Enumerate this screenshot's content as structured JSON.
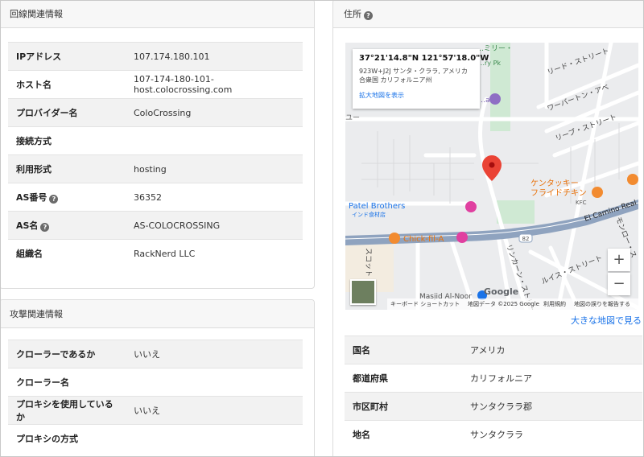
{
  "line_card": {
    "title": "回線関連情報",
    "rows": [
      {
        "key": "IPアドレス",
        "value": "107.174.180.101",
        "help": false
      },
      {
        "key": "ホスト名",
        "value": "107-174-180-101-host.colocrossing.com",
        "help": false
      },
      {
        "key": "プロバイダー名",
        "value": "ColoCrossing",
        "help": false
      },
      {
        "key": "接続方式",
        "value": "",
        "help": false
      },
      {
        "key": "利用形式",
        "value": "hosting",
        "help": false
      },
      {
        "key": "AS番号",
        "value": "36352",
        "help": true
      },
      {
        "key": "AS名",
        "value": "AS-COLOCROSSING",
        "help": true
      },
      {
        "key": "組織名",
        "value": "RackNerd LLC",
        "help": false
      }
    ]
  },
  "attack_card": {
    "title": "攻撃関連情報",
    "rows": [
      {
        "key": "クローラーであるか",
        "value": "いいえ"
      },
      {
        "key": "クローラー名",
        "value": ""
      },
      {
        "key": "プロキシを使用しているか",
        "value": "いいえ"
      },
      {
        "key": "プロキシの方式",
        "value": ""
      }
    ]
  },
  "address_card": {
    "title": "住所",
    "help_icon": "question-circle-icon",
    "map": {
      "coords": "37°21'14.8\"N 121°57'18.0\"W",
      "address": "923W+J2J サンタ・クララ, アメリカ合衆国 カリフォルニア州",
      "enlarge_link": "拡大地図を表示",
      "zoom_in": "+",
      "zoom_out": "−",
      "google_logo": "Google",
      "attribution": {
        "shortcuts": "キーボード ショートカット",
        "map_data": "地図データ ©2025 Google",
        "terms": "利用規約",
        "report": "地図の誤りを報告する"
      },
      "labels": {
        "store_top": "…ミリー・",
        "store_sub": "…ry Pk",
        "art": "…art",
        "street_reed": "リード・ストリート",
        "street_warburton": "ワーバートン・アベ",
        "street_reeve": "リーブ・ストリート",
        "kfc_jp": "ケンタッキー",
        "kfc_jp2": "フライドチキン",
        "kfc": "KFC",
        "el_camino": "El Camino Real",
        "patel": "Patel Brothers",
        "patel_sub": "インド食材店",
        "chickfila": "Chick-fil-A",
        "route": "82",
        "scott": "スコット",
        "lincoln": "リンカーン・ストリート",
        "lewis": "ルイス・ストリート",
        "monroe": "モンロー・ス",
        "masjid": "Masjid Al-Noor",
        "left_frag": "ユー"
      },
      "accent": "#ea4335"
    },
    "big_map_link": "大きな地図で見る",
    "rows": [
      {
        "key": "国名",
        "value": "アメリカ"
      },
      {
        "key": "都道府県",
        "value": "カリフォルニア"
      },
      {
        "key": "市区町村",
        "value": "サンタクララ郡"
      },
      {
        "key": "地名",
        "value": "サンタクララ"
      }
    ]
  }
}
